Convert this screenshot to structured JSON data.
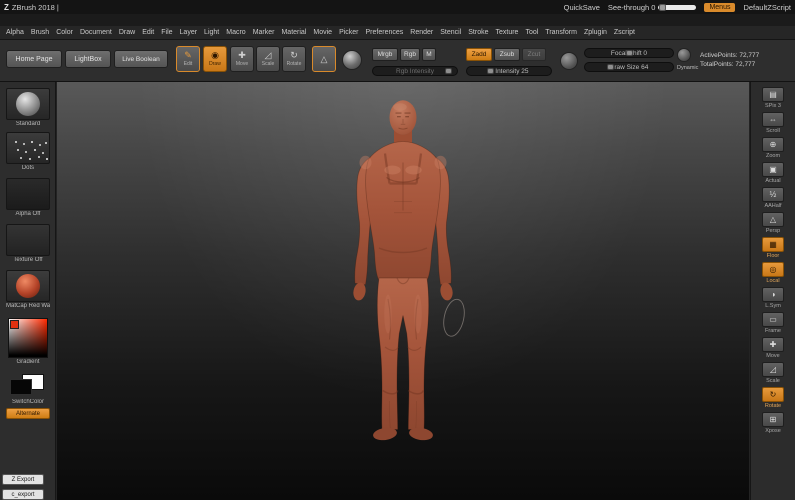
{
  "title_bar": {
    "logo": "Z",
    "app_title": "ZBrush 2018 |",
    "quicksave": "QuickSave",
    "see_through": "See-through 0",
    "menus": "Menus",
    "zscript": "DefaultZScript"
  },
  "menu_bar": {
    "items": [
      "Alpha",
      "Brush",
      "Color",
      "Document",
      "Draw",
      "Edit",
      "File",
      "Layer",
      "Light",
      "Macro",
      "Marker",
      "Material",
      "Movie",
      "Picker",
      "Preferences",
      "Render",
      "Stencil",
      "Stroke",
      "Texture",
      "Tool",
      "Transform",
      "Zplugin",
      "Zscript"
    ]
  },
  "toolbar": {
    "home_page": "Home Page",
    "lightbox": "LightBox",
    "live_boolean": "Live Boolean",
    "edit": "Edit",
    "draw": "Draw",
    "move": "Move",
    "scale": "Scale",
    "rotate": "Rotate",
    "mrgb": "Mrgb",
    "rgb": "Rgb",
    "m": "M",
    "rgb_intensity": "Rgb Intensity",
    "zadd": "Zadd",
    "zsub": "Zsub",
    "zcut": "Zcut",
    "z_intensity": "Z Intensity 25",
    "focal_shift": "Focal Shift 0",
    "draw_size": "Draw Size 64",
    "dynamic": "Dynamic",
    "active_points": "ActivePoints: 72,777",
    "total_points": "TotalPoints: 72,777"
  },
  "left_shelf": {
    "brush_label": "Standard",
    "stroke_label": "Dots",
    "alpha_label": "Alpha Off",
    "texture_label": "Texture Off",
    "material_label": "MatCap Red Wax",
    "gradient_label": "Gradient",
    "switch_label": "SwitchColor",
    "alternate_label": "Alternate",
    "export1": "Z Export",
    "export2": "c_export"
  },
  "right_shelf": {
    "items": [
      {
        "label": "SPix 3"
      },
      {
        "label": "Scroll"
      },
      {
        "label": "Zoom"
      },
      {
        "label": "Actual"
      },
      {
        "label": "AAHalf"
      },
      {
        "label": "Persp"
      },
      {
        "label": "Floor"
      },
      {
        "label": "Local"
      },
      {
        "label": "L.Sym"
      },
      {
        "label": "Frame"
      },
      {
        "label": "Move"
      },
      {
        "label": "Scale"
      },
      {
        "label": "Rotate"
      },
      {
        "label": "Xpose"
      }
    ]
  },
  "icons": {
    "edit": "✎",
    "draw": "◉",
    "move": "✚",
    "scale": "◿",
    "rotate": "↻",
    "sculptris": "△",
    "spix": "▤",
    "scroll": "⇔",
    "zoom": "⊕",
    "actual": "▣",
    "aahalf": "½",
    "persp": "△",
    "floor": "▦",
    "local": "◎",
    "lsym": "◑",
    "frame": "▭",
    "xpose": "⊞"
  },
  "colors": {
    "accent": "#d98a2b",
    "clay": "#a8573a",
    "canvas_top": "#595959",
    "canvas_bottom": "#0a0a0a"
  }
}
